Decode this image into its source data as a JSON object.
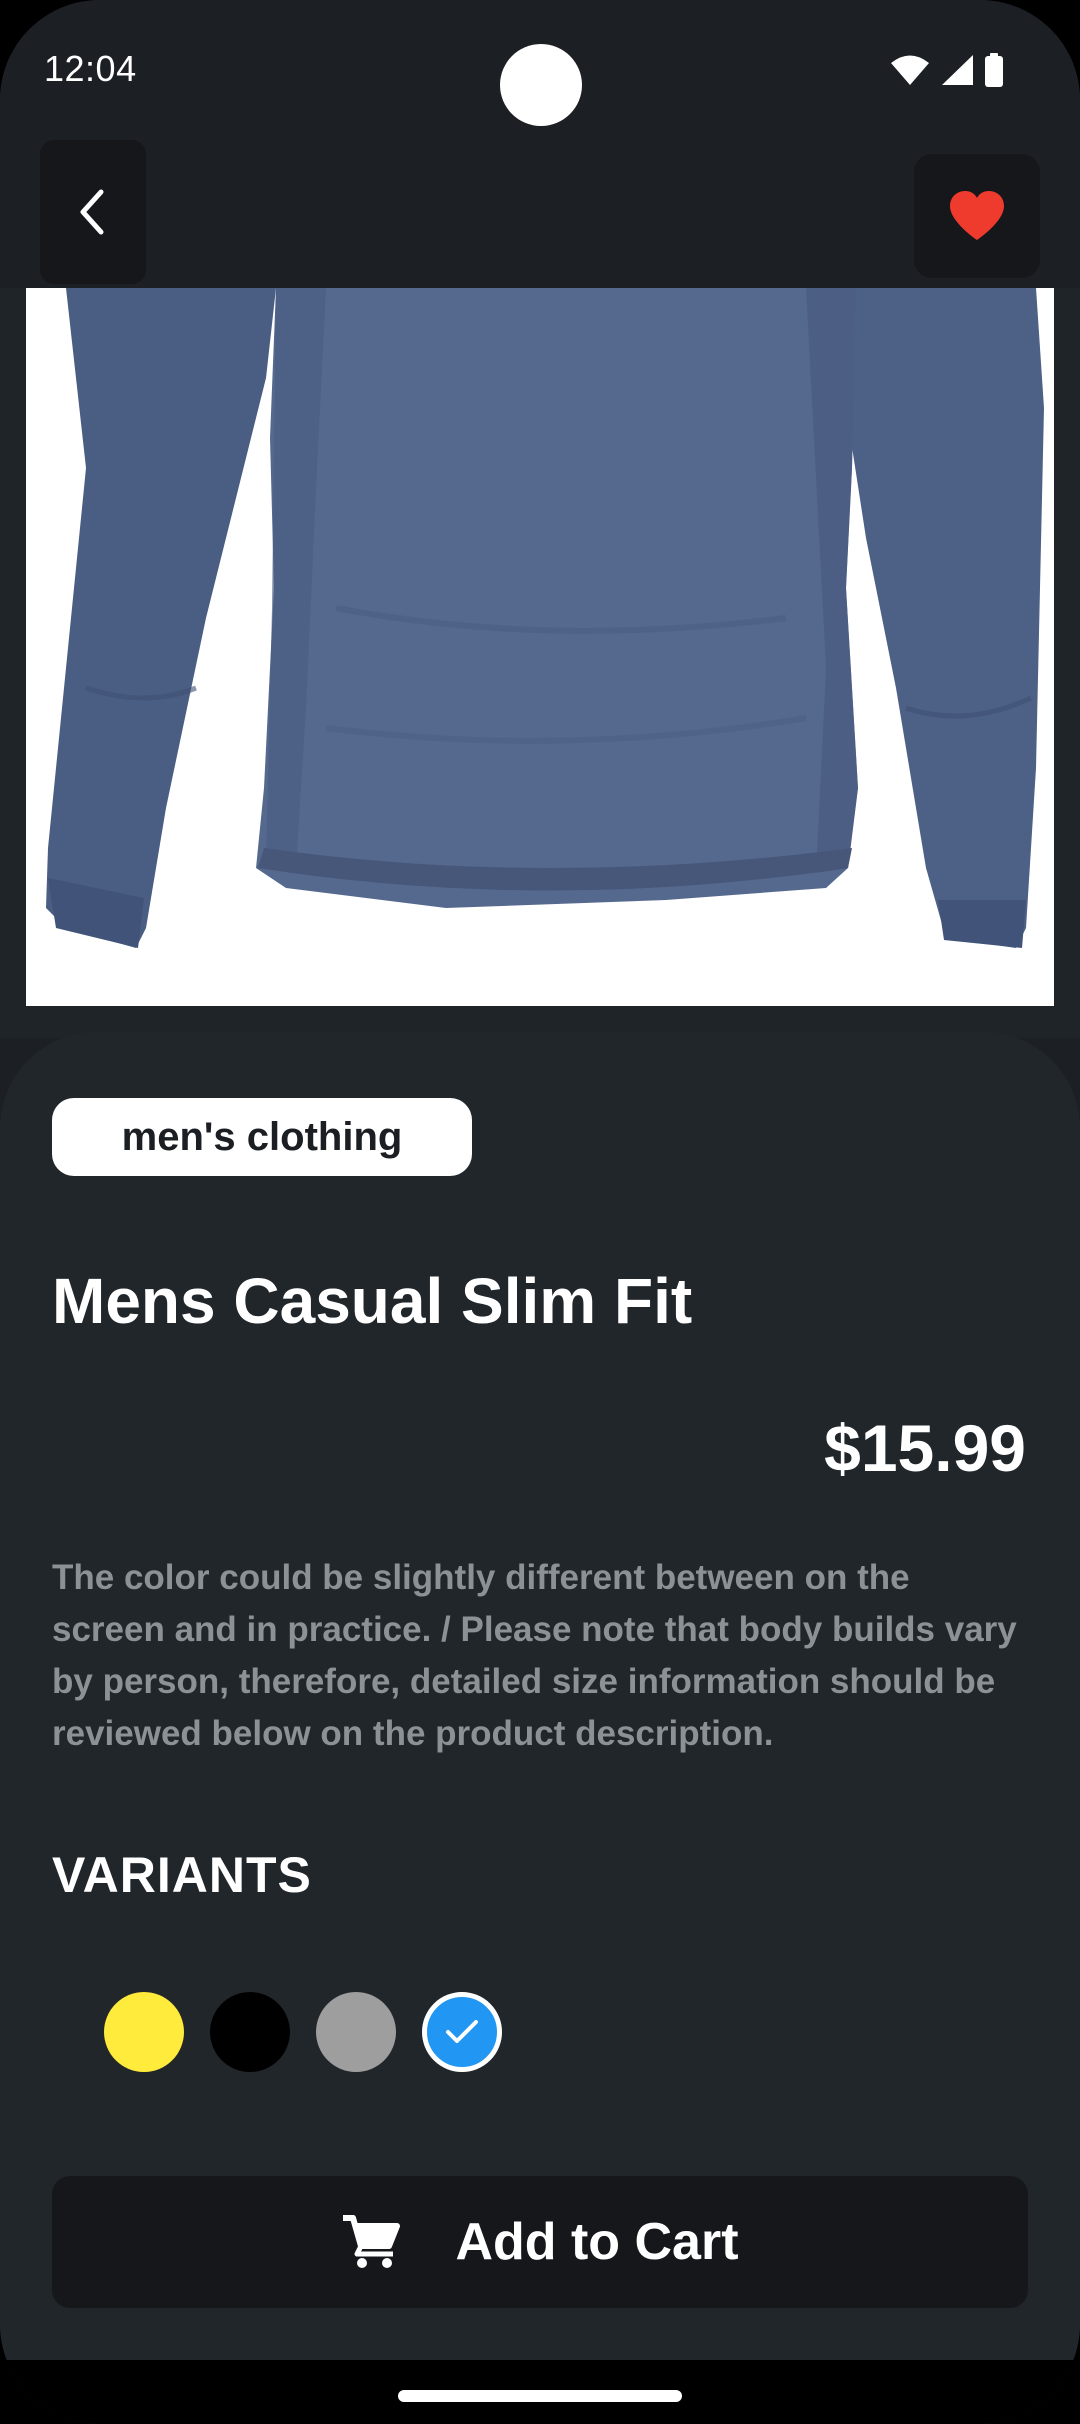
{
  "status_bar": {
    "time": "12:04",
    "icons": [
      "wifi-icon",
      "cellular-signal-icon",
      "battery-icon"
    ]
  },
  "top_bar": {
    "back_icon": "chevron-left-icon",
    "favorite_icon": "heart-icon",
    "favorite_color": "#ef3b2d",
    "favorited": true
  },
  "product": {
    "image": "blue long sleeve t-shirt",
    "category": "men's clothing",
    "title": "Mens Casual Slim Fit",
    "price": "$15.99",
    "description": "The color could be slightly different between on the screen and in practice. / Please note that body builds vary by person, therefore, detailed size information should be reviewed below on the product description."
  },
  "variants": {
    "heading": "VARIANTS",
    "swatches": [
      {
        "name": "yellow",
        "color": "#ffeb3b",
        "selected": false
      },
      {
        "name": "black",
        "color": "#000000",
        "selected": false
      },
      {
        "name": "grey",
        "color": "#9e9e9e",
        "selected": false
      },
      {
        "name": "blue",
        "color": "#2196f3",
        "selected": true
      }
    ]
  },
  "cart": {
    "label": "Add to Cart",
    "icon": "cart-icon"
  },
  "colors": {
    "background": "#1c1f24",
    "sheet": "#21262b",
    "button": "#15171b",
    "text": "#ffffff",
    "muted_text": "#8c9196"
  }
}
